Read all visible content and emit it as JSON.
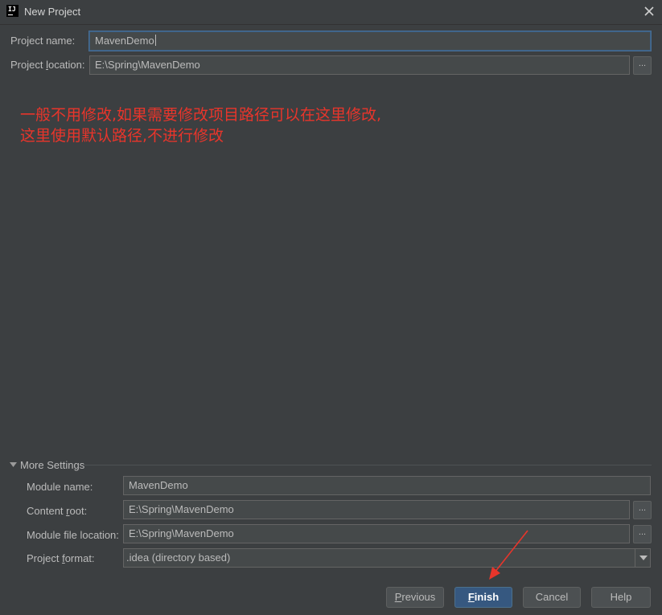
{
  "window": {
    "title": "New Project",
    "logo": "IJ"
  },
  "project": {
    "name_label": "Project name:",
    "name_value": "MavenDemo",
    "location_label_pre": "Project ",
    "location_label_u": "l",
    "location_label_post": "ocation:",
    "location_value": "E:\\Spring\\MavenDemo",
    "browse_label": "..."
  },
  "annotation": {
    "line1": "一般不用修改,如果需要修改项目路径可以在这里修改,",
    "line2": "这里使用默认路径,不进行修改",
    "color": "#e8352b"
  },
  "more_settings": {
    "toggle_label": "More Settings",
    "module_name_label": "Module name:",
    "module_name_value": "MavenDemo",
    "content_root_label_pre": "Content ",
    "content_root_label_u": "r",
    "content_root_label_post": "oot:",
    "content_root_value": "E:\\Spring\\MavenDemo",
    "module_file_label": "Module file location:",
    "module_file_value": "E:\\Spring\\MavenDemo",
    "project_format_label_pre": "Project ",
    "project_format_label_u": "f",
    "project_format_label_post": "ormat:",
    "project_format_value": ".idea (directory based)"
  },
  "buttons": {
    "previous_u": "P",
    "previous_rest": "revious",
    "finish_u": "F",
    "finish_rest": "inish",
    "cancel": "Cancel",
    "help": "Help"
  },
  "colors": {
    "background": "#3c3f41",
    "accent": "#365880",
    "arrow": "#e8352b"
  }
}
